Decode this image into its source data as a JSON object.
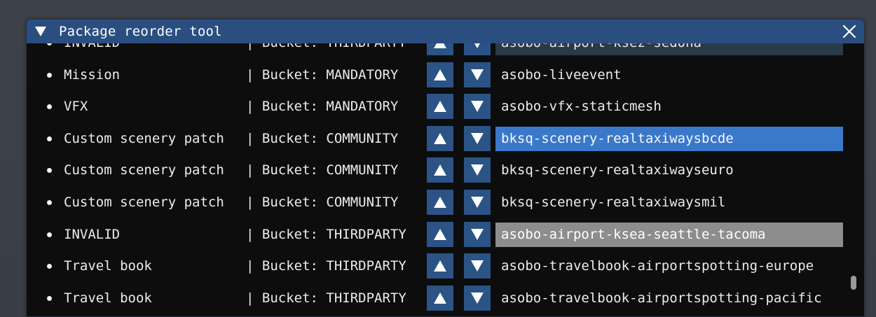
{
  "window": {
    "title": "Package reorder tool",
    "colors": {
      "titlebar": "#2a4e80",
      "button": "#2b5385",
      "selected": "#3a78c9",
      "hovered": "#8d8d8d",
      "background": "#0d0d0e"
    },
    "icons": {
      "collapse": "triangle-down-icon",
      "close": "close-icon",
      "move_up": "arrow-up-icon",
      "move_down": "arrow-down-icon"
    }
  },
  "rows": [
    {
      "name": "INVALID",
      "sep": "|",
      "bucket": "Bucket: THIRDPARTY",
      "package": "asobo-airport-ksez-sedona",
      "state": "dim"
    },
    {
      "name": "Mission",
      "sep": "|",
      "bucket": "Bucket: MANDATORY",
      "package": "asobo-liveevent",
      "state": ""
    },
    {
      "name": "VFX",
      "sep": "|",
      "bucket": "Bucket: MANDATORY",
      "package": "asobo-vfx-staticmesh",
      "state": ""
    },
    {
      "name": "Custom scenery patch",
      "sep": "|",
      "bucket": "Bucket: COMMUNITY",
      "package": "bksq-scenery-realtaxiwaysbcde",
      "state": "selected"
    },
    {
      "name": "Custom scenery patch",
      "sep": "|",
      "bucket": "Bucket: COMMUNITY",
      "package": "bksq-scenery-realtaxiwayseuro",
      "state": ""
    },
    {
      "name": "Custom scenery patch",
      "sep": "|",
      "bucket": "Bucket: COMMUNITY",
      "package": "bksq-scenery-realtaxiwaysmil",
      "state": ""
    },
    {
      "name": "INVALID",
      "sep": "|",
      "bucket": "Bucket: THIRDPARTY",
      "package": "asobo-airport-ksea-seattle-tacoma",
      "state": "hovered"
    },
    {
      "name": "Travel book",
      "sep": "|",
      "bucket": "Bucket: THIRDPARTY",
      "package": "asobo-travelbook-airportspotting-europe",
      "state": ""
    },
    {
      "name": "Travel book",
      "sep": "|",
      "bucket": "Bucket: THIRDPARTY",
      "package": "asobo-travelbook-airportspotting-pacific",
      "state": ""
    }
  ]
}
